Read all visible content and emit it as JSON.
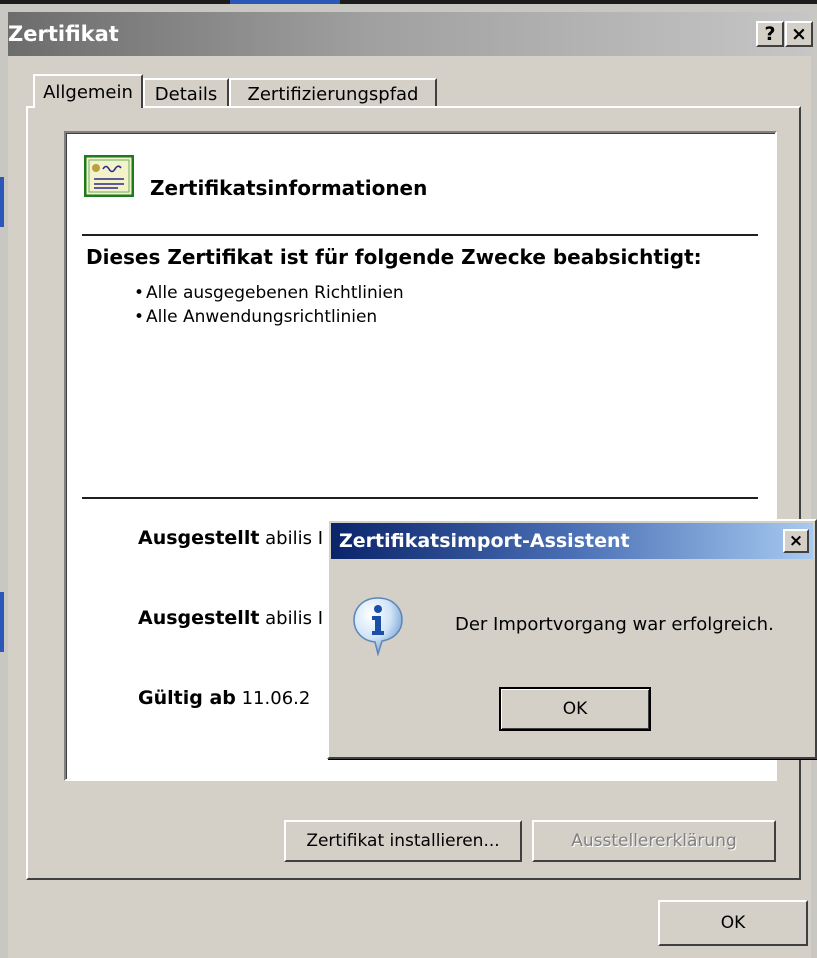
{
  "dialog": {
    "title": "Zertifikat",
    "help_glyph": "?",
    "close_glyph": "×"
  },
  "tabs": [
    {
      "label": "Allgemein",
      "active": true
    },
    {
      "label": "Details",
      "active": false
    },
    {
      "label": "Zertifizierungspfad",
      "active": false
    }
  ],
  "info": {
    "heading": "Zertifikatsinformationen",
    "purpose_title": "Dieses Zertifikat ist für folgende Zwecke beabsichtigt:",
    "purposes": [
      "Alle ausgegebenen Richtlinien",
      "Alle Anwendungsrichtlinien"
    ],
    "issued_to_label": "Ausgestellt",
    "issued_to_value": "abilis I",
    "issued_by_label": "Ausgestellt",
    "issued_by_value": "abilis I",
    "valid_label": "Gültig ab",
    "valid_value": "11.06.2"
  },
  "buttons": {
    "install": "Zertifikat installieren...",
    "issuer_statement": "Ausstellererklärung",
    "ok": "OK"
  },
  "messagebox": {
    "title": "Zertifikatsimport-Assistent",
    "message": "Der Importvorgang war erfolgreich.",
    "ok": "OK",
    "close_glyph": "×",
    "icon": "info-icon"
  },
  "colors": {
    "face": "#d4d0c8",
    "inactive_title": "#808080",
    "active_title": "#0a246a"
  }
}
